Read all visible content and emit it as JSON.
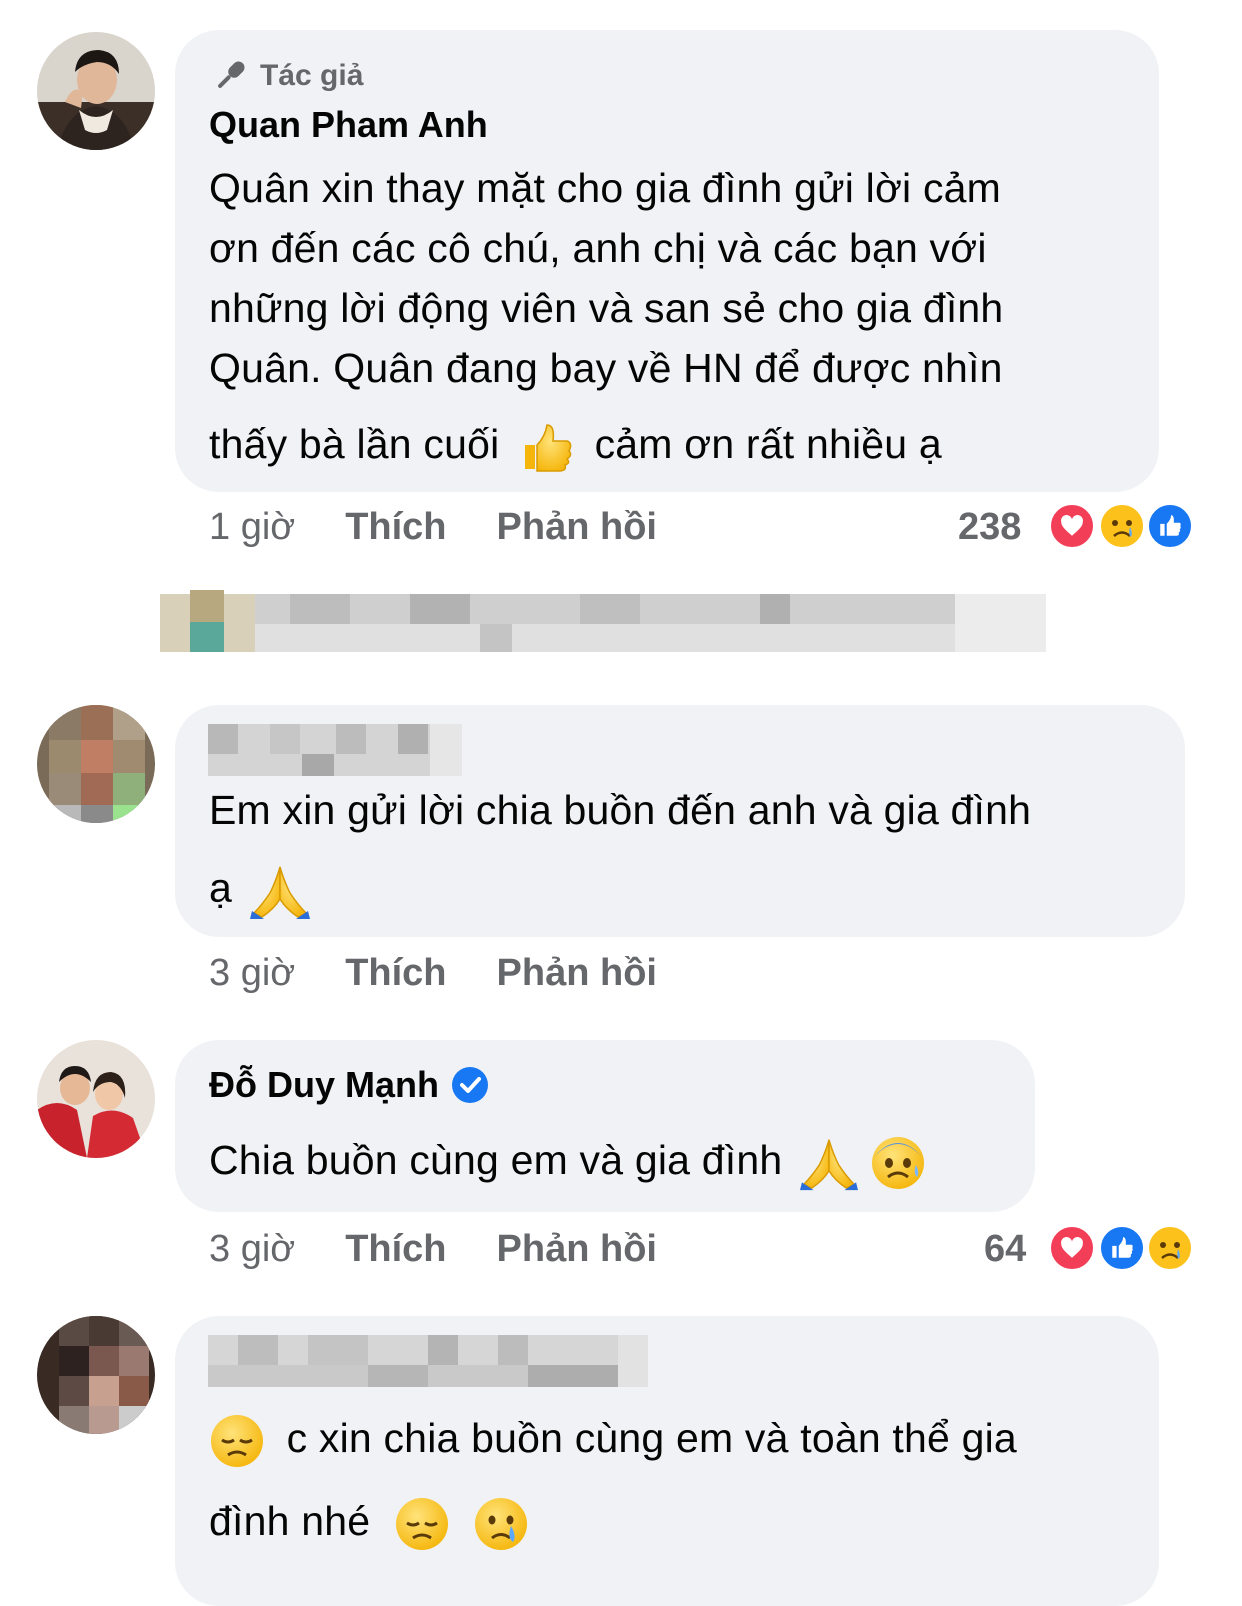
{
  "comments": [
    {
      "author_badge": "Tác giả",
      "author_name": "Quan Pham Anh",
      "lines": [
        "Quân xin thay mặt cho gia đình gửi lời cảm",
        "ơn đến các cô chú, anh chị và các bạn với",
        "những lời động viên và san sẻ cho gia đình",
        "Quân. Quân đang bay về HN để được nhìn"
      ],
      "last_line_before": "thấy bà lần cuối",
      "last_line_after": "cảm ơn rất nhiều ạ",
      "inline_icon": "thumbs-up-emoji",
      "time": "1 giờ",
      "like_label": "Thích",
      "reply_label": "Phản hồi",
      "reaction_count": "238",
      "reactions": [
        "love",
        "sad",
        "like"
      ]
    },
    {
      "author_name_blurred": true,
      "line1": "Em xin gửi lời chia buồn đến anh và gia đình",
      "line2": "ạ",
      "inline_icon": "folded-hands-emoji",
      "time": "3 giờ",
      "like_label": "Thích",
      "reply_label": "Phản hồi"
    },
    {
      "author_name": "Đỗ Duy Mạnh",
      "verified_icon": "verified-badge-icon",
      "line1": "Chia buồn cùng em và gia đình",
      "inline_icons": [
        "folded-hands-emoji",
        "anxious-face-emoji"
      ],
      "time": "3 giờ",
      "like_label": "Thích",
      "reply_label": "Phản hồi",
      "reaction_count": "64",
      "reactions": [
        "love",
        "like",
        "sad"
      ]
    },
    {
      "author_name_blurred": true,
      "line1": "c xin chia buồn cùng em và toàn thể gia",
      "line2": "đình nhé",
      "inline_icons": [
        "disappointed-face-emoji",
        "disappointed-face-emoji",
        "crying-face-emoji"
      ]
    }
  ],
  "colors": {
    "bubble": "#f0f2f5",
    "meta": "#65676b",
    "like_blue": "#1877f2",
    "love_red": "#f33e58",
    "emoji_yellow": "#fcc21b"
  }
}
